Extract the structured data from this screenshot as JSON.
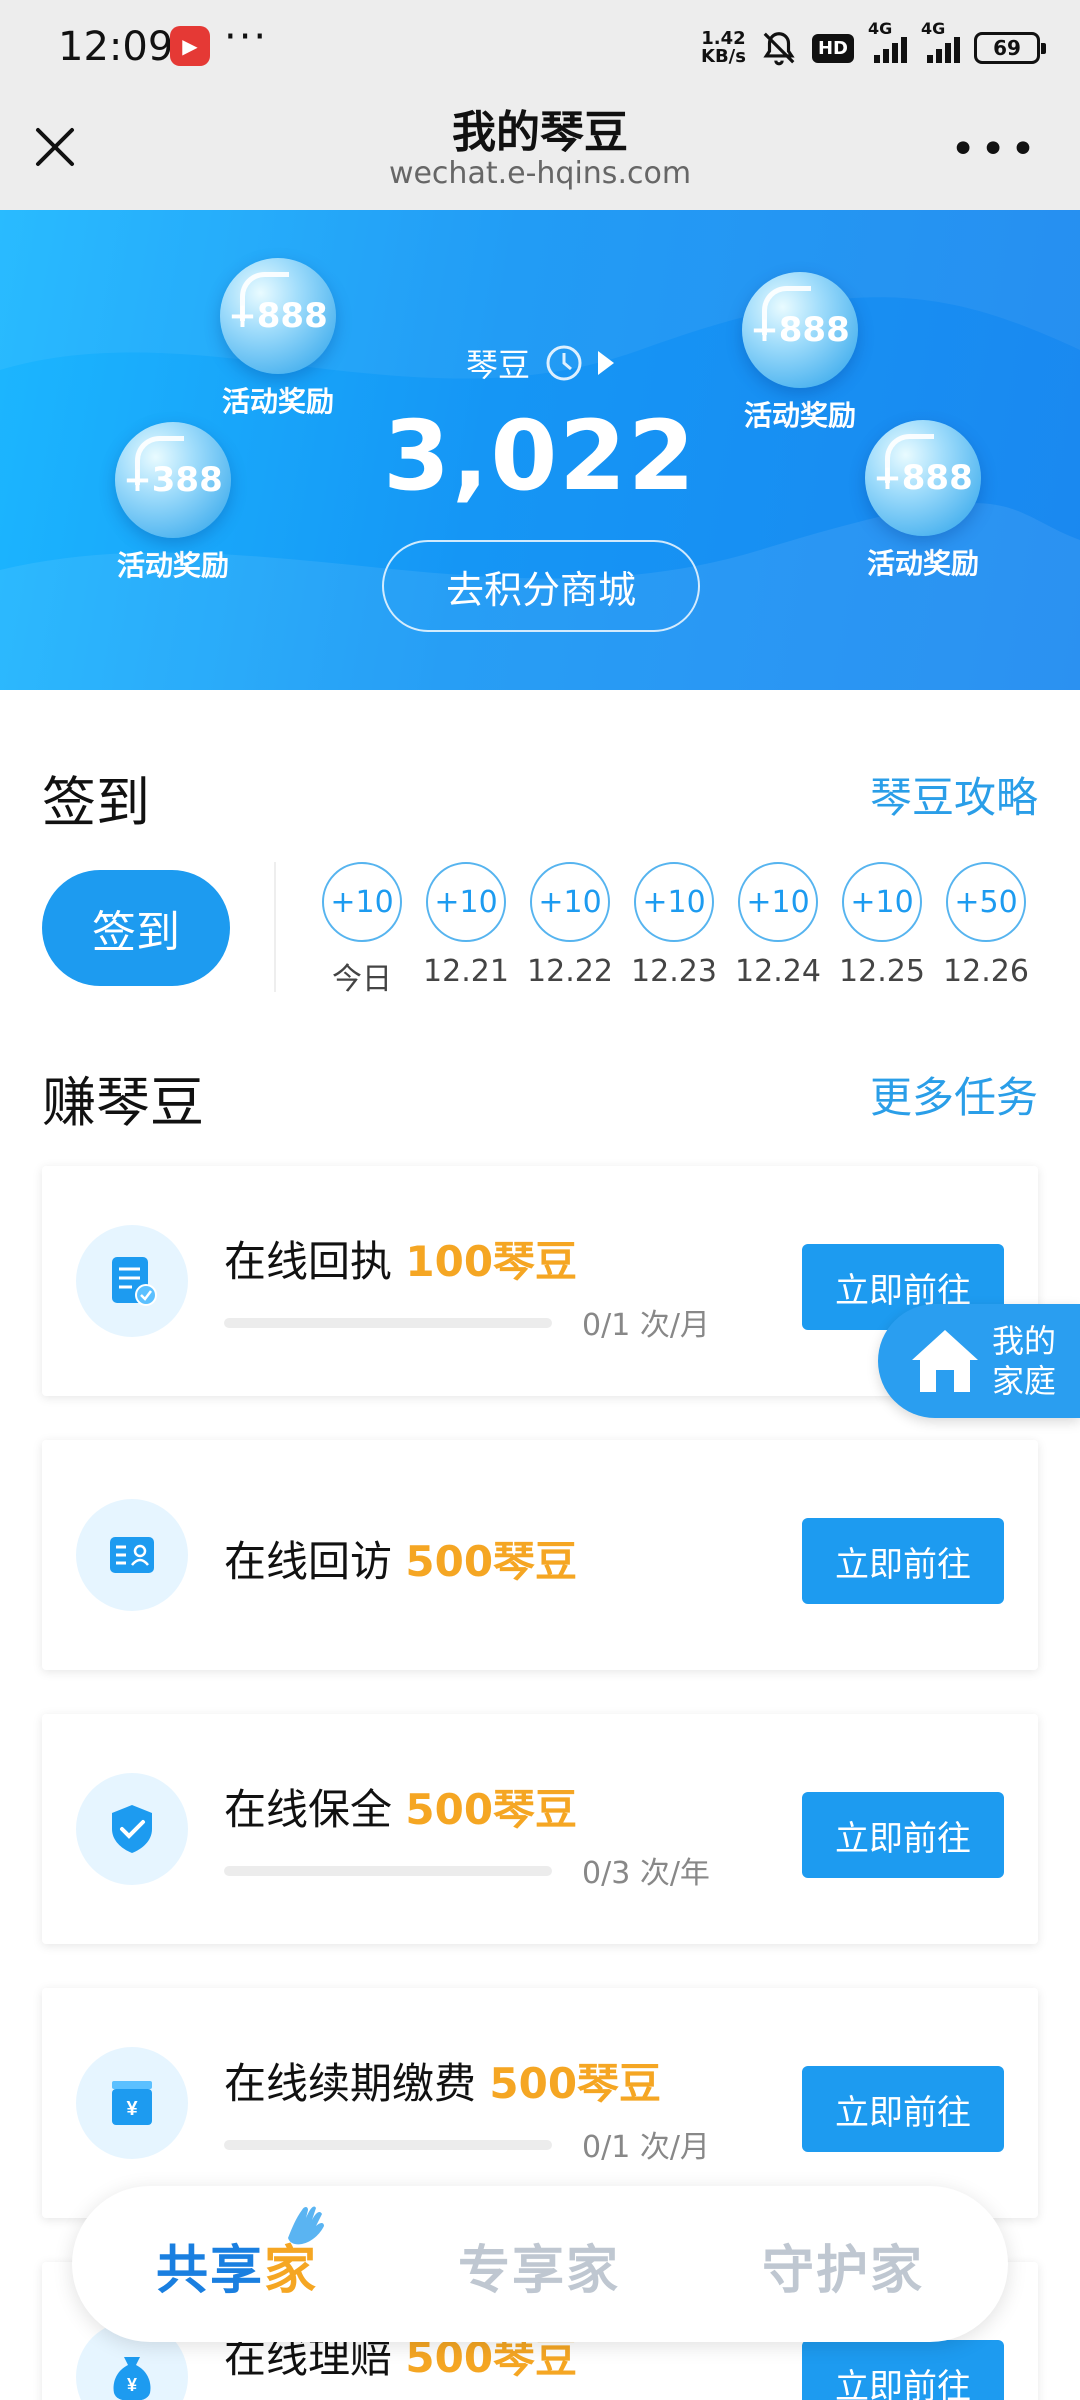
{
  "status_bar": {
    "time": "12:09",
    "more": "···",
    "net_speed_value": "1.42",
    "net_speed_unit": "KB/s",
    "hd_label": "HD",
    "signal1_label": "4G",
    "signal2_label": "4G",
    "battery": "69"
  },
  "nav": {
    "title": "我的琴豆",
    "url": "wechat.e-hqins.com"
  },
  "hero": {
    "points_label": "琴豆",
    "points_value": "3,022",
    "mall_button": "去积分商城",
    "bubbles": [
      {
        "value": "+888",
        "label": "活动奖励"
      },
      {
        "value": "+388",
        "label": "活动奖励"
      },
      {
        "value": "+888",
        "label": "活动奖励"
      },
      {
        "value": "+888",
        "label": "活动奖励"
      }
    ]
  },
  "signin": {
    "title": "签到",
    "guide_link": "琴豆攻略",
    "button": "签到",
    "days": [
      {
        "reward": "+10",
        "label": "今日"
      },
      {
        "reward": "+10",
        "label": "12.21"
      },
      {
        "reward": "+10",
        "label": "12.22"
      },
      {
        "reward": "+10",
        "label": "12.23"
      },
      {
        "reward": "+10",
        "label": "12.24"
      },
      {
        "reward": "+10",
        "label": "12.25"
      },
      {
        "reward": "+50",
        "label": "12.26"
      }
    ]
  },
  "earn": {
    "title": "赚琴豆",
    "more_link": "更多任务",
    "tasks": [
      {
        "name": "在线回执",
        "reward": "100琴豆",
        "progress": "0/1 次/月",
        "progress_fraction": 0,
        "button": "立即前往"
      },
      {
        "name": "在线回访",
        "reward": "500琴豆",
        "button": "立即前往"
      },
      {
        "name": "在线保全",
        "reward": "500琴豆",
        "progress": "0/3 次/年",
        "progress_fraction": 0,
        "button": "立即前往"
      },
      {
        "name": "在线续期缴费",
        "reward": "500琴豆",
        "progress": "0/1 次/月",
        "progress_fraction": 0,
        "button": "立即前往"
      },
      {
        "name": "在线理赔",
        "reward": "500琴豆",
        "button": "立即前往"
      }
    ]
  },
  "float_button": {
    "line1": "我的",
    "line2": "家庭"
  },
  "tabbar": {
    "tabs": [
      {
        "part1": "共享",
        "part2": "家"
      },
      {
        "part1": "专享家",
        "part2": ""
      },
      {
        "part1": "守护家",
        "part2": ""
      }
    ]
  },
  "colors": {
    "primary": "#1d9bf0",
    "reward": "#f5a623",
    "link": "#2a9ee8"
  }
}
